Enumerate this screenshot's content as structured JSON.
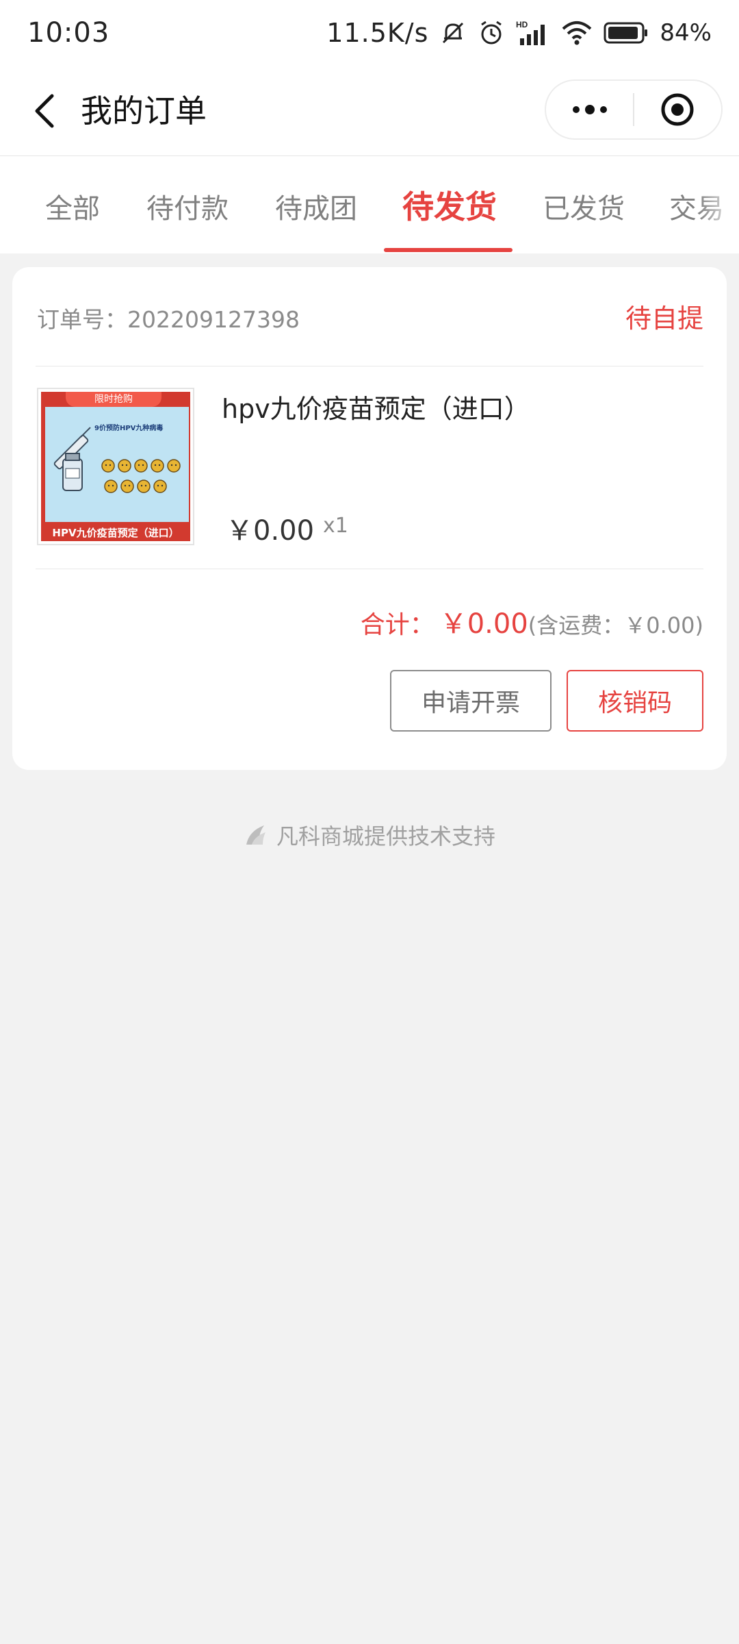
{
  "status_bar": {
    "time": "10:03",
    "network_speed": "11.5K/s",
    "battery": "84%"
  },
  "header": {
    "title": "我的订单"
  },
  "tabs": [
    {
      "label": "全部"
    },
    {
      "label": "待付款"
    },
    {
      "label": "待成团"
    },
    {
      "label": "待发货",
      "active": true
    },
    {
      "label": "已发货"
    },
    {
      "label": "交易"
    }
  ],
  "order": {
    "order_no_label": "订单号：",
    "order_no": "202209127398",
    "status": "待自提",
    "product": {
      "name": "hpv九价疫苗预定（进口）",
      "price": "￥0.00",
      "quantity": "x1",
      "image": {
        "tag": "限时抢购",
        "headline": "9价预防HPV九种病毒",
        "banner": "HPV九价疫苗预定（进口）"
      }
    },
    "total_label": "合计：",
    "total_value": "￥0.00",
    "shipping_note": "(含运费：￥0.00)",
    "buttons": {
      "invoice": "申请开票",
      "verify_code": "核销码"
    }
  },
  "footer": {
    "support_text": "凡科商城提供技术支持"
  },
  "colors": {
    "accent": "#e64340",
    "background": "#f2f2f2"
  }
}
